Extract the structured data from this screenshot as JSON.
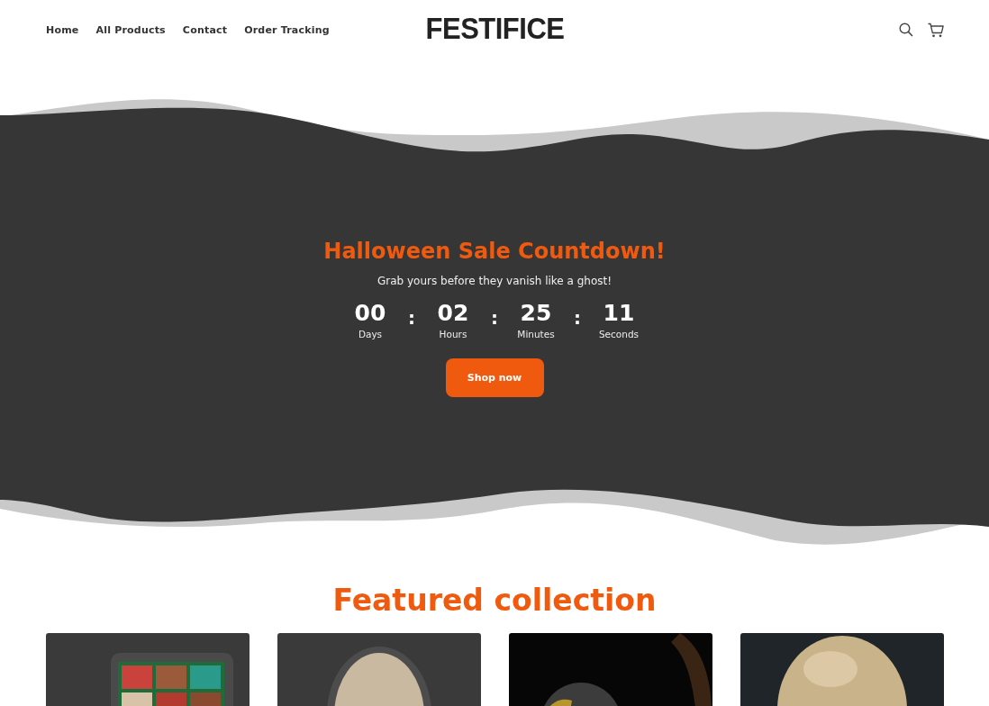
{
  "header": {
    "nav": [
      {
        "label": "Home"
      },
      {
        "label": "All Products"
      },
      {
        "label": "Contact"
      },
      {
        "label": "Order Tracking"
      }
    ],
    "logo": "FESTIFICE"
  },
  "hero": {
    "title": "Halloween Sale Countdown!",
    "subtitle": "Grab yours before they vanish like a ghost!",
    "countdown": [
      {
        "value": "00",
        "label": "Days"
      },
      {
        "value": "02",
        "label": "Hours"
      },
      {
        "value": "25",
        "label": "Minutes"
      },
      {
        "value": "11",
        "label": "Seconds"
      }
    ],
    "separator": ":",
    "button": "Shop now"
  },
  "featured": {
    "title": "Featured collection"
  }
}
